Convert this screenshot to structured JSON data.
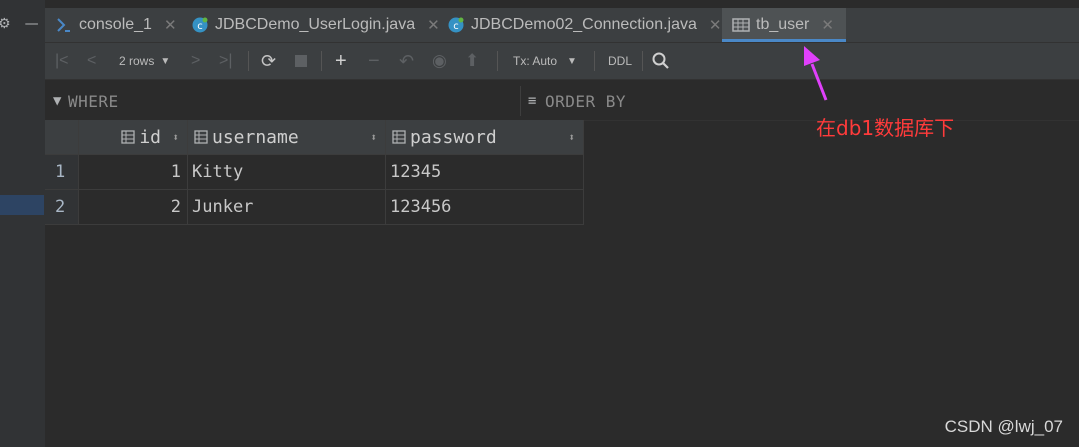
{
  "tabs": [
    {
      "label": "console_1",
      "icon": "console-icon"
    },
    {
      "label": "JDBCDemo_UserLogin.java",
      "icon": "java-class-icon"
    },
    {
      "label": "JDBCDemo02_Connection.java",
      "icon": "java-class-icon"
    },
    {
      "label": "tb_user",
      "icon": "table-icon",
      "active": true
    }
  ],
  "toolbar": {
    "rows_label": "2 rows",
    "tx_label": "Tx: Auto",
    "ddl_label": "DDL"
  },
  "filter": {
    "where_label": "WHERE",
    "order_label": "ORDER BY"
  },
  "table": {
    "columns": [
      "id",
      "username",
      "password"
    ],
    "rows": [
      {
        "num": "1",
        "id": "1",
        "username": "Kitty",
        "password": "12345"
      },
      {
        "num": "2",
        "id": "2",
        "username": "Junker",
        "password": "123456"
      }
    ]
  },
  "annotation": {
    "text": "在db1数据库下",
    "color": "#ff3b3b",
    "arrow_color": "#e040fb"
  },
  "watermark": "CSDN @lwj_07",
  "colors": {
    "background": "#2b2b2b",
    "panel": "#3c3f41",
    "active_tab_underline": "#4a88c7"
  }
}
